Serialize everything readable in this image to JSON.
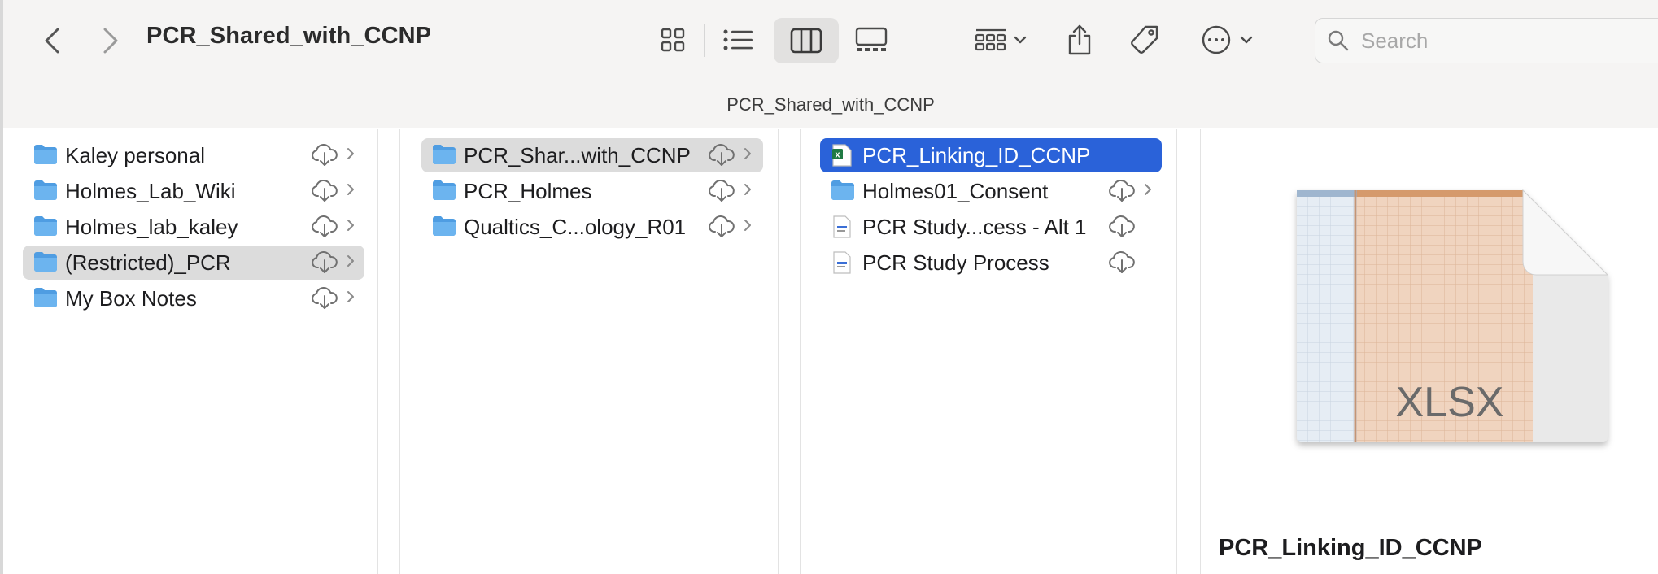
{
  "toolbar": {
    "title": "PCR_Shared_with_CCNP",
    "search_placeholder": "Search",
    "icons": [
      "chevron-left-icon",
      "chevron-right-icon",
      "grid-view-icon",
      "list-view-icon",
      "column-view-icon",
      "gallery-view-icon",
      "group-icon",
      "share-icon",
      "tag-icon",
      "more-icon"
    ]
  },
  "pathbar": {
    "text": "PCR_Shared_with_CCNP"
  },
  "column1": {
    "items": [
      {
        "label": "Kaley personal"
      },
      {
        "label": "Holmes_Lab_Wiki"
      },
      {
        "label": "Holmes_lab_kaley"
      },
      {
        "label": "(Restricted)_PCR",
        "selected": true
      },
      {
        "label": "My Box Notes"
      }
    ]
  },
  "column2": {
    "items": [
      {
        "label": "PCR_Shar...with_CCNP",
        "selected": true
      },
      {
        "label": "PCR_Holmes"
      },
      {
        "label": "Qualtics_C...ology_R01"
      }
    ]
  },
  "column3": {
    "items": [
      {
        "label": "PCR_Linking_ID_CCNP",
        "selected": true,
        "type": "xlsx"
      },
      {
        "label": "Holmes01_Consent",
        "type": "folder"
      },
      {
        "label": "PCR Study...cess - Alt 1",
        "type": "doc"
      },
      {
        "label": "PCR Study Process",
        "type": "doc"
      }
    ]
  },
  "preview": {
    "badge": "XLSX",
    "name": "PCR_Linking_ID_CCNP"
  },
  "colors": {
    "selection_blue": "#2a62d9",
    "selection_gray": "#dcdcdc",
    "folder_blue": "#5aa9e8",
    "excel_green": "#1f7a44"
  }
}
